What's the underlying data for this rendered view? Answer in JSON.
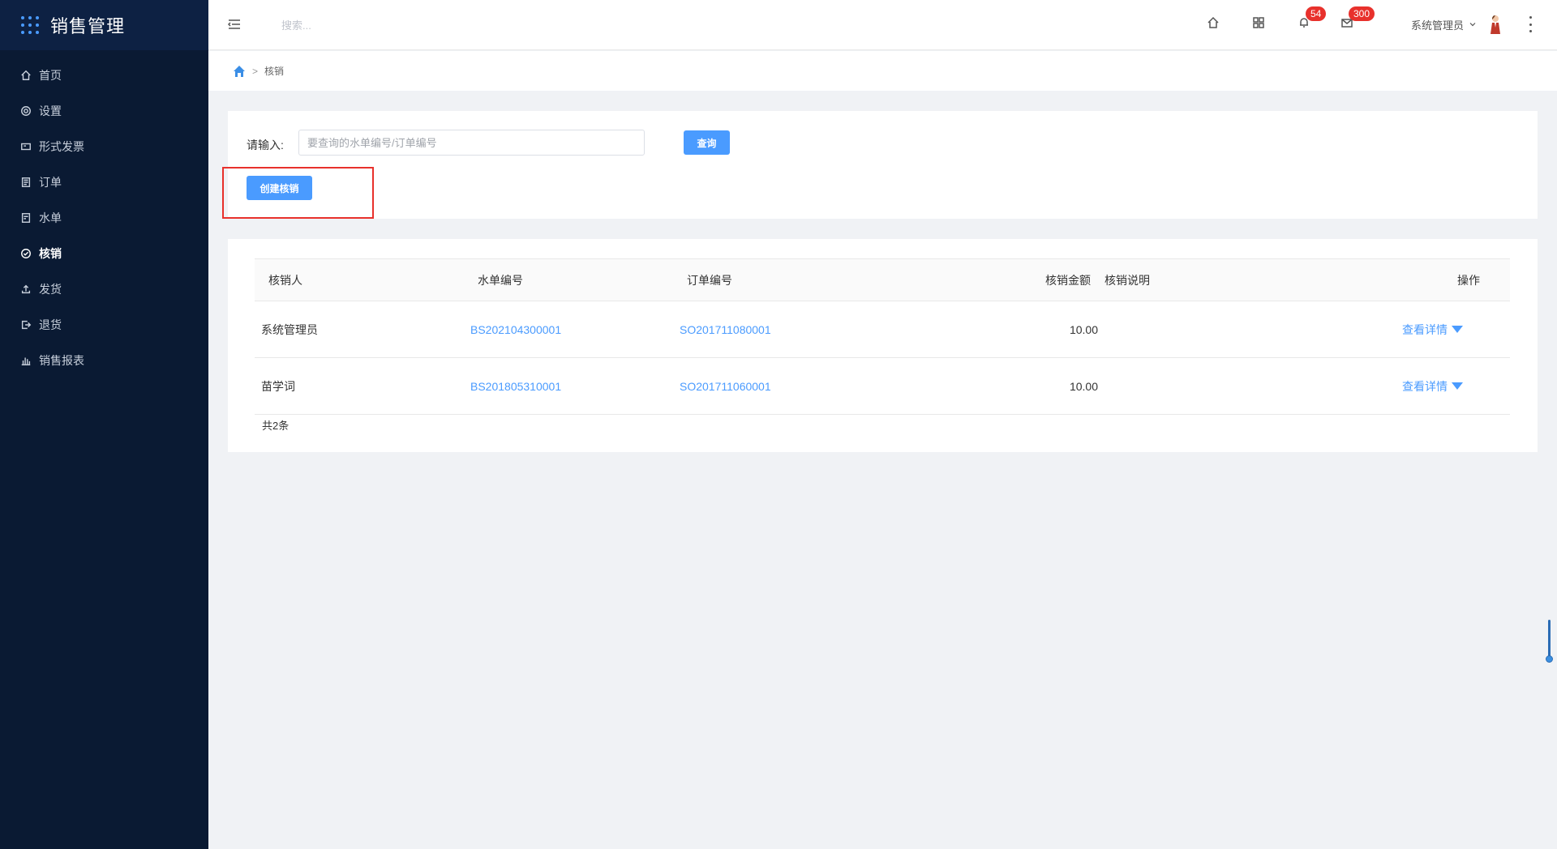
{
  "app": {
    "title": "销售管理"
  },
  "sidebar": {
    "items": [
      {
        "label": "首页",
        "icon": "home-icon",
        "active": false
      },
      {
        "label": "设置",
        "icon": "gear-icon",
        "active": false
      },
      {
        "label": "形式发票",
        "icon": "invoice-icon",
        "active": false
      },
      {
        "label": "订单",
        "icon": "order-icon",
        "active": false
      },
      {
        "label": "水单",
        "icon": "receipt-icon",
        "active": false
      },
      {
        "label": "核销",
        "icon": "check-circle-icon",
        "active": true
      },
      {
        "label": "发货",
        "icon": "upload-icon",
        "active": false
      },
      {
        "label": "退货",
        "icon": "return-icon",
        "active": false
      },
      {
        "label": "销售报表",
        "icon": "bar-chart-icon",
        "active": false
      }
    ]
  },
  "header": {
    "search_placeholder": "搜索...",
    "notifications_badge": "54",
    "messages_badge": "300",
    "user_name": "系统管理员"
  },
  "breadcrumb": {
    "separator": ">",
    "current": "核销"
  },
  "filter": {
    "label": "请输入:",
    "input_placeholder": "要查询的水单编号/订单编号",
    "input_value": "",
    "query_button": "查询",
    "create_button": "创建核销"
  },
  "table": {
    "columns": [
      "核销人",
      "水单编号",
      "订单编号",
      "核销金额",
      "核销说明",
      "操作"
    ],
    "rows": [
      {
        "person": "系统管理员",
        "receipt_no": "BS202104300001",
        "order_no": "SO201711080001",
        "amount": "10.00",
        "note": "",
        "action": "查看详情"
      },
      {
        "person": "苗学词",
        "receipt_no": "BS201805310001",
        "order_no": "SO201711060001",
        "amount": "10.00",
        "note": "",
        "action": "查看详情"
      }
    ],
    "total": "共2条"
  },
  "colors": {
    "sidebar_bg": "#0a1a33",
    "accent": "#4a9bff",
    "badge": "#e8312c"
  }
}
